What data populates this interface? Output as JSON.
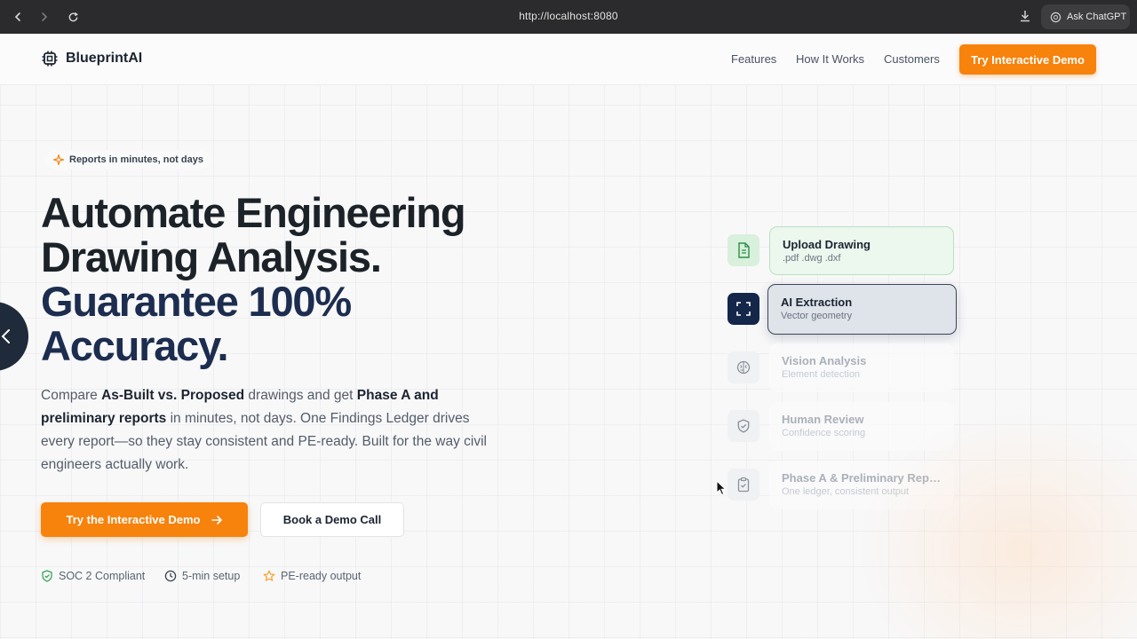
{
  "browser": {
    "url": "http://localhost:8080",
    "ask_label": "Ask ChatGPT"
  },
  "header": {
    "brand": "BlueprintAI",
    "nav": [
      "Features",
      "How It Works",
      "Customers"
    ],
    "cta": "Try Interactive Demo"
  },
  "hero": {
    "badge": "Reports in minutes, not days",
    "headline_lines": [
      "Automate Engineering",
      "Drawing Analysis."
    ],
    "headline_accent_lines": [
      "Guarantee 100%",
      "Accuracy."
    ],
    "description": {
      "p1": "Compare ",
      "b1": "As-Built vs. Proposed",
      "p2": " drawings and get ",
      "b2": "Phase A and preliminary reports",
      "p3": " in minutes, not days. One Findings Ledger drives every report—so they stay consistent and PE-ready. Built for the way civil engineers actually work."
    },
    "primary_button": "Try the Interactive Demo",
    "secondary_button": "Book a Demo Call",
    "trust_badges": [
      "SOC 2 Compliant",
      "5-min setup",
      "PE-ready output"
    ]
  },
  "pipeline": [
    {
      "title": "Upload Drawing",
      "subtitle": ".pdf .dwg .dxf",
      "icon": "file-icon",
      "state": "done"
    },
    {
      "title": "AI Extraction",
      "subtitle": "Vector geometry",
      "icon": "scan-icon",
      "state": "active"
    },
    {
      "title": "Vision Analysis",
      "subtitle": "Element detection",
      "icon": "brain-icon",
      "state": "pending"
    },
    {
      "title": "Human Review",
      "subtitle": "Confidence scoring",
      "icon": "shield-check-icon",
      "state": "pending"
    },
    {
      "title": "Phase A & Preliminary Repo...",
      "subtitle": "One ledger, consistent output",
      "icon": "clipboard-check-icon",
      "state": "pending"
    }
  ],
  "colors": {
    "accent": "#f7820c",
    "navy": "#1c2d4f",
    "success": "#3aa45a"
  }
}
